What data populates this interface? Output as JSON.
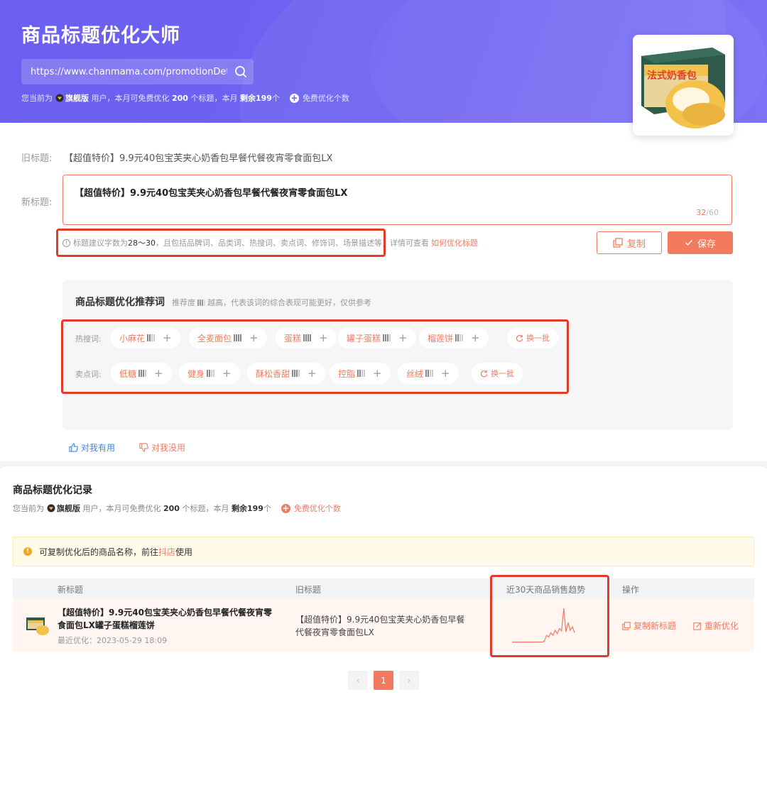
{
  "header": {
    "title": "商品标题优化大师",
    "url_value": "https://www.chanmama.com/promotionDetail",
    "quota": {
      "prefix": "您当前为",
      "plan": "旗舰版",
      "mid": "用户，本月可免费优化",
      "count": "200",
      "mid2": "个标题，本月",
      "remain": "剩余199",
      "suffix": "个",
      "free_link": "免费优化个数"
    }
  },
  "editor": {
    "old_label": "旧标题:",
    "old_title": "【超值特价】9.9元40包宝芙夹心奶香包早餐代餐夜宵零食面包LX",
    "new_label": "新标题:",
    "new_title": "【超值特价】9.9元40包宝芙夹心奶香包早餐代餐夜宵零食面包LX",
    "count_current": "32",
    "count_total": "/60",
    "tip_prefix": "标题建议字数为",
    "tip_range": "28～30",
    "tip_body": "，且包括品牌词、品类词、热搜词、卖点词、修饰词、场景描述等，详情可查看",
    "tip_link": "如何优化标题",
    "copy_label": "复制",
    "save_label": "保存"
  },
  "recommend": {
    "title": "商品标题优化推荐词",
    "sub_prefix": "推荐度",
    "sub_suffix": "越高，代表该词的综合表现可能更好，仅供参考",
    "hot_label": "热搜词:",
    "sell_label": "卖点词:",
    "refresh_label": "换一批",
    "hot_words": [
      {
        "word": "小麻花",
        "level": 2
      },
      {
        "word": "全麦面包",
        "level": 4
      },
      {
        "word": "蛋糕",
        "level": 4
      },
      {
        "word": "罐子蛋糕",
        "level": 3
      },
      {
        "word": "榴莲饼",
        "level": 2
      }
    ],
    "sell_words": [
      {
        "word": "低糖",
        "level": 3
      },
      {
        "word": "健身",
        "level": 2
      },
      {
        "word": "酥松香甜",
        "level": 3
      },
      {
        "word": "控脂",
        "level": 2
      },
      {
        "word": "丝绒",
        "level": 2
      }
    ],
    "useful_label": "对我有用",
    "useless_label": "对我没用"
  },
  "records": {
    "title": "商品标题优化记录",
    "quota": {
      "prefix": "您当前为",
      "plan": "旗舰版",
      "mid": "用户，本月可免费优化",
      "count": "200",
      "mid2": "个标题，本月",
      "remain": "剩余199",
      "suffix": "个",
      "free_link": "免费优化个数"
    },
    "notice_prefix": "可复制优化后的商品名称，前往",
    "notice_link": "抖店",
    "notice_suffix": "使用",
    "columns": [
      "新标题",
      "旧标题",
      "近30天商品销售趋势",
      "操作"
    ],
    "row": {
      "new_title": "【超值特价】9.9元40包宝芙夹心奶香包早餐代餐夜宵零食面包LX罐子蛋糕榴莲饼",
      "recent": "最近优化：2023-05-29 18:09",
      "old_title": "【超值特价】9.9元40包宝芙夹心奶香包早餐代餐夜宵零食面包LX",
      "op_copy": "复制新标题",
      "op_reopt": "重新优化",
      "trend": [
        2,
        2,
        2,
        2,
        2,
        2,
        2,
        2,
        2,
        2,
        2,
        2,
        2,
        2,
        2,
        3,
        10,
        8,
        13,
        10,
        16,
        12,
        18,
        15,
        42,
        14,
        25,
        16,
        20,
        13
      ]
    },
    "pager": {
      "prev": "‹",
      "current": "1",
      "next": "›"
    }
  },
  "colors": {
    "brand": "#6a5ff0",
    "accent": "#f07b62",
    "highlight_frame": "#e53a28"
  }
}
